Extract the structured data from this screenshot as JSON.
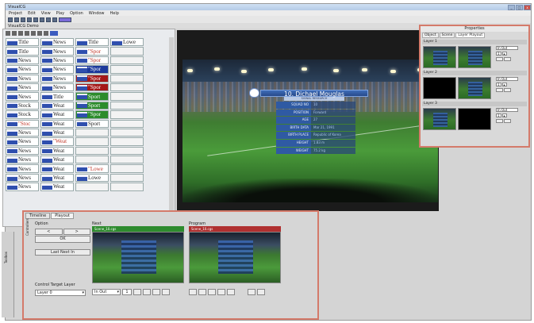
{
  "app": {
    "title": "VisualCG",
    "window_buttons": [
      "_",
      "□",
      "x"
    ],
    "menu": [
      "Project",
      "Edit",
      "View",
      "Play",
      "Option",
      "Window",
      "Help"
    ],
    "document_tab": "VisualCG Demo"
  },
  "templates": {
    "items": [
      {
        "label": "Title",
        "style": "plain"
      },
      {
        "label": "News",
        "style": "plain"
      },
      {
        "label": "Title",
        "style": "plain"
      },
      {
        "label": "Lowe",
        "style": "plain"
      },
      {
        "label": "Title",
        "style": "plain"
      },
      {
        "label": "News",
        "style": "plain"
      },
      {
        "label": "\"Spor",
        "style": "red"
      },
      {
        "label": "",
        "style": "empty"
      },
      {
        "label": "News",
        "style": "plain"
      },
      {
        "label": "News",
        "style": "plain"
      },
      {
        "label": "\"Spor",
        "style": "red"
      },
      {
        "label": "",
        "style": "empty"
      },
      {
        "label": "News",
        "style": "plain"
      },
      {
        "label": "News",
        "style": "plain"
      },
      {
        "label": "\"Spor",
        "style": "blu"
      },
      {
        "label": "",
        "style": "empty"
      },
      {
        "label": "News",
        "style": "plain"
      },
      {
        "label": "News",
        "style": "plain"
      },
      {
        "label": "\"Spor",
        "style": "redbg"
      },
      {
        "label": "",
        "style": "empty"
      },
      {
        "label": "News",
        "style": "plain"
      },
      {
        "label": "News",
        "style": "plain"
      },
      {
        "label": "\"Spor",
        "style": "redbg"
      },
      {
        "label": "",
        "style": "empty"
      },
      {
        "label": "News",
        "style": "plain"
      },
      {
        "label": "Title",
        "style": "plain"
      },
      {
        "label": "Sport",
        "style": "grn"
      },
      {
        "label": "",
        "style": "empty"
      },
      {
        "label": "Stock",
        "style": "plain"
      },
      {
        "label": "Weat",
        "style": "plain"
      },
      {
        "label": "Sport",
        "style": "grn"
      },
      {
        "label": "",
        "style": "empty"
      },
      {
        "label": "Stock",
        "style": "plain"
      },
      {
        "label": "Weat",
        "style": "plain"
      },
      {
        "label": "\"Spor",
        "style": "grn"
      },
      {
        "label": "",
        "style": "empty"
      },
      {
        "label": "\"Stoc",
        "style": "red"
      },
      {
        "label": "Weat",
        "style": "plain"
      },
      {
        "label": "Sport",
        "style": "plain"
      },
      {
        "label": "",
        "style": "empty"
      },
      {
        "label": "News",
        "style": "plain"
      },
      {
        "label": "Weat",
        "style": "plain"
      },
      {
        "label": "",
        "style": "empty"
      },
      {
        "label": "",
        "style": "empty"
      },
      {
        "label": "News",
        "style": "plain"
      },
      {
        "label": "\"Weat",
        "style": "red"
      },
      {
        "label": "",
        "style": "empty"
      },
      {
        "label": "",
        "style": "empty"
      },
      {
        "label": "News",
        "style": "plain"
      },
      {
        "label": "Weat",
        "style": "plain"
      },
      {
        "label": "",
        "style": "empty"
      },
      {
        "label": "",
        "style": "empty"
      },
      {
        "label": "News",
        "style": "plain"
      },
      {
        "label": "Weat",
        "style": "plain"
      },
      {
        "label": "",
        "style": "empty"
      },
      {
        "label": "",
        "style": "empty"
      },
      {
        "label": "News",
        "style": "plain"
      },
      {
        "label": "Weat",
        "style": "plain"
      },
      {
        "label": "\"Lowe",
        "style": "red"
      },
      {
        "label": "",
        "style": "empty"
      },
      {
        "label": "News",
        "style": "plain"
      },
      {
        "label": "Weat",
        "style": "plain"
      },
      {
        "label": "Lowe",
        "style": "plain"
      },
      {
        "label": "",
        "style": "empty"
      },
      {
        "label": "News",
        "style": "plain"
      },
      {
        "label": "Weat",
        "style": "plain"
      },
      {
        "label": "",
        "style": "empty"
      },
      {
        "label": "",
        "style": "empty"
      }
    ]
  },
  "card": {
    "title": "10. Dichael Mouglas",
    "subtitle": "SIGNAL RESEARCH",
    "rows": [
      {
        "label": "SQUAD NO",
        "value": "10"
      },
      {
        "label": "POSITION",
        "value": "Forward"
      },
      {
        "label": "AGE",
        "value": "27"
      },
      {
        "label": "BIRTH DATA",
        "value": "Mar 21, 1991"
      },
      {
        "label": "BIRTH PLACE",
        "value": "Republic of Korea"
      },
      {
        "label": "HEIGHT",
        "value": "1.83 m"
      },
      {
        "label": "WEIGHT",
        "value": "75.2 kg"
      }
    ]
  },
  "properties": {
    "title": "Properties",
    "tabs": [
      "Object",
      "Scene",
      "Layer Playout"
    ],
    "layers": [
      {
        "name": "Layer 1",
        "mode": "In Out",
        "count": "1"
      },
      {
        "name": "Layer 2",
        "mode": "In Out",
        "count": "1"
      },
      {
        "name": "Layer 3",
        "mode": "In Out",
        "count": "1"
      }
    ]
  },
  "playout": {
    "tabs": [
      "Timeline",
      "Playout"
    ],
    "side_label": "Controllers",
    "option_label": "Option",
    "btn_left": "<",
    "btn_right": ">",
    "ok": "OK",
    "last_next_in": "Last Next In",
    "control_target_label": "Control Target Layer",
    "target_layer": "Layer 0",
    "next_label": "Next",
    "next_bar": "Scene_10.cgs",
    "program_label": "Program",
    "program_bar": "Scene_10.cgs",
    "mode": "In Out",
    "count": "1"
  },
  "sidebar_label": "Toolbox",
  "colors": {
    "accent_border": "#d47a6a",
    "next_green": "#2e8b2e",
    "program_red": "#b03030"
  }
}
